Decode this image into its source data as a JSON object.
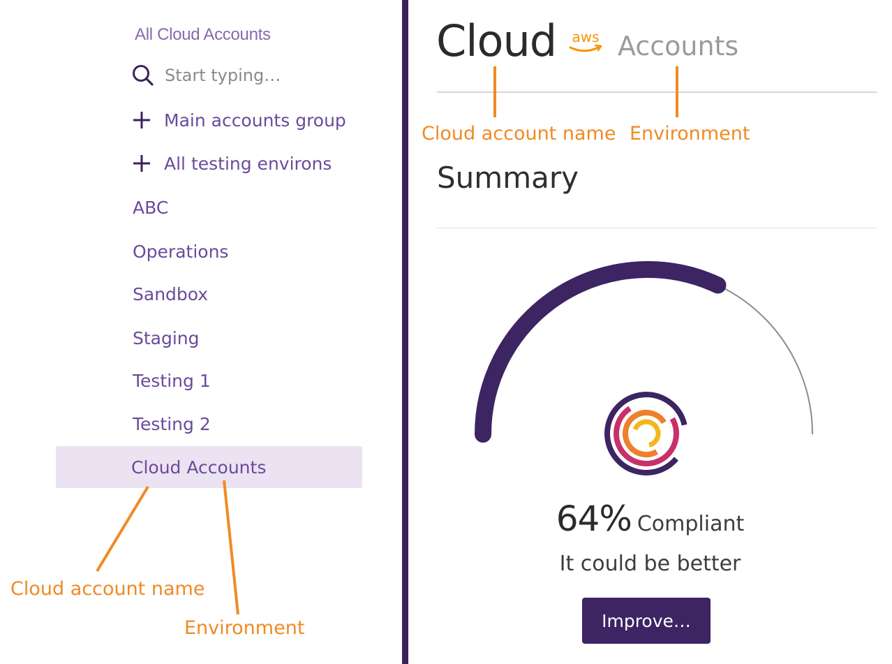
{
  "sidebar": {
    "title": "All Cloud Accounts",
    "search": {
      "placeholder": "Start typing…",
      "value": ""
    },
    "groups": [
      {
        "label": "Main accounts group",
        "icon": "plus-icon"
      },
      {
        "label": "All testing environs",
        "icon": "plus-icon"
      }
    ],
    "items": [
      "ABC",
      "Operations",
      "Sandbox",
      "Staging",
      "Testing 1",
      "Testing 2"
    ],
    "selected": {
      "name": "Cloud",
      "environment": "Accounts"
    }
  },
  "header": {
    "account_name": "Cloud",
    "provider_logo": "aws-logo",
    "provider_text": "aws",
    "environment": "Accounts"
  },
  "summary": {
    "title": "Summary",
    "compliance_percent": 64,
    "compliance_value": "64%",
    "compliance_label": "Compliant",
    "tagline": "It could be better",
    "improve_label": "Improve…"
  },
  "annotations": {
    "header_account": "Cloud account name",
    "header_environment": "Environment",
    "sidebar_account": "Cloud account name",
    "sidebar_environment": "Environment"
  },
  "colors": {
    "brand_purple": "#3d2462",
    "link_purple": "#6b4a9c",
    "selected_bg": "#ebe3f1",
    "annotation_orange": "#f08a24",
    "aws_orange": "#f79400"
  }
}
